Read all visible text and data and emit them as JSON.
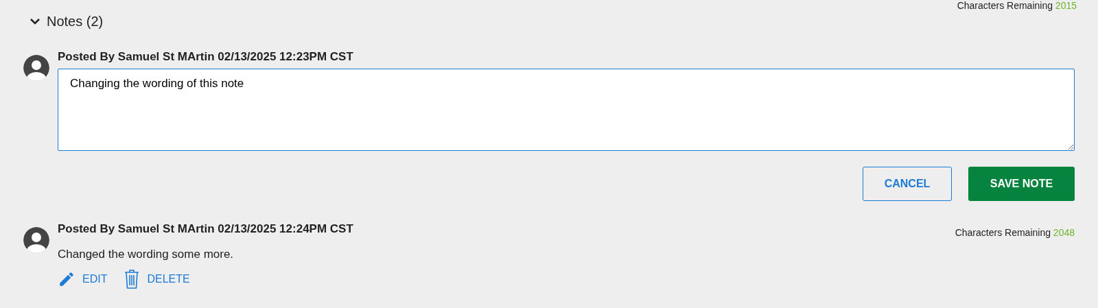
{
  "top_counter": {
    "label": "Characters Remaining",
    "count": "2015"
  },
  "section": {
    "title": "Notes (2)",
    "expanded": true
  },
  "notes": [
    {
      "kind": "editing",
      "posted": "Posted By Samuel St MArtin 02/13/2025 12:23PM CST",
      "value": "Changing the wording of this note",
      "focused": true,
      "buttons": [
        {
          "kind": "secondary",
          "label": "CANCEL"
        },
        {
          "kind": "primary",
          "label": "SAVE NOTE"
        }
      ]
    },
    {
      "kind": "view",
      "posted": "Posted By Samuel St MArtin 02/13/2025 12:24PM CST",
      "text": "Changed the wording some more.",
      "counter": {
        "label": "Characters Remaining",
        "count": "2048"
      },
      "actions": [
        {
          "kind": "edit",
          "label": "EDIT"
        },
        {
          "kind": "delete",
          "label": "DELETE"
        }
      ]
    }
  ]
}
